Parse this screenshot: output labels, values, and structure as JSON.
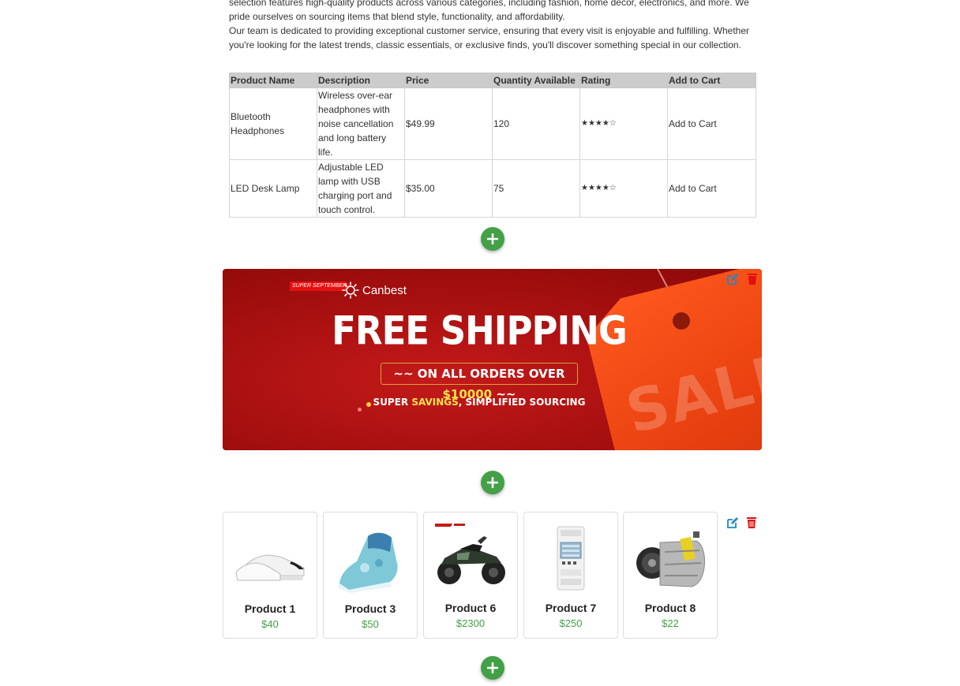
{
  "intro": {
    "paragraph1": "selection features high-quality products across various categories, including fashion, home decor, electronics, and more. We pride ourselves on sourcing items that blend style, functionality, and affordability.",
    "paragraph2": "Our team is dedicated to providing exceptional customer service, ensuring that every visit is enjoyable and fulfilling. Whether you're looking for the latest trends, classic essentials, or exclusive finds, you'll discover something special in our collection."
  },
  "table": {
    "headers": [
      "Product Name",
      "Description",
      "Price",
      "Quantity Available",
      "Rating",
      "Add to Cart"
    ],
    "rows": [
      {
        "name": "Bluetooth Headphones",
        "description": "Wireless over-ear headphones with noise cancellation and long battery life.",
        "price": "$49.99",
        "quantity": "120",
        "rating": "★★★★☆",
        "cart": "Add to Cart"
      },
      {
        "name": "LED Desk Lamp",
        "description": "Adjustable LED lamp with USB charging port and touch control.",
        "price": "$35.00",
        "quantity": "75",
        "rating": "★★★★☆",
        "cart": "Add to Cart"
      }
    ]
  },
  "banner": {
    "badge": "SUPER SEPTEMBER",
    "brand": "Canbest",
    "headline": "FREE SHIPPING",
    "orders_prefix": "~~ ON ALL ORDERS OVER ",
    "orders_amount": "$10000",
    "orders_suffix": " ~~",
    "savings_prefix": "SUPER ",
    "savings_highlight": "SAVINGS",
    "savings_suffix": ", SIMPLIFIED SOURCING",
    "watermark": "SALE"
  },
  "products": [
    {
      "name": "Product 1",
      "price": "$40"
    },
    {
      "name": "Product 3",
      "price": "$50"
    },
    {
      "name": "Product 6",
      "price": "$2300"
    },
    {
      "name": "Product 7",
      "price": "$250"
    },
    {
      "name": "Product 8",
      "price": "$22"
    }
  ],
  "colors": {
    "accent_green": "#43a047",
    "edit_blue": "#1e88c7",
    "delete_red": "#e01010",
    "banner_red": "#a50f0f"
  },
  "icons": [
    "plus-icon",
    "edit-icon",
    "delete-icon"
  ]
}
